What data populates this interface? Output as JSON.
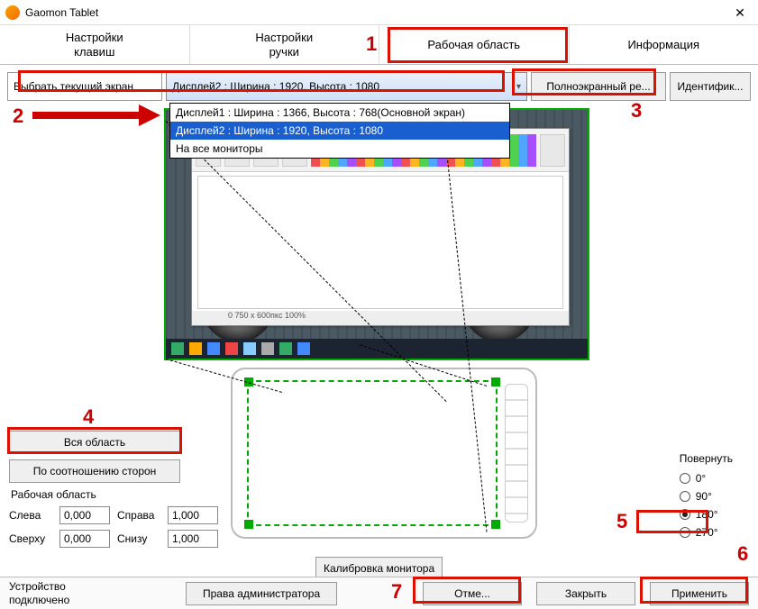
{
  "window": {
    "title": "Gaomon Tablet"
  },
  "tabs": {
    "keys": "Настройки\nклавиш",
    "pen": "Настройки\nручки",
    "work": "Рабочая область",
    "info": "Информация"
  },
  "selector": {
    "label": "Выбрать текущий экран",
    "selected": "Дисплей2 : Ширина : 1920, Высота : 1080",
    "options": {
      "o1": "Дисплей1 : Ширина : 1366, Высота : 768(Основной экран)",
      "o2": "Дисплей2 : Ширина : 1920, Высота : 1080",
      "o3": "На все мониторы"
    },
    "fullscreen": "Полноэкранный ре...",
    "identify": "Идентифик..."
  },
  "paint": {
    "status": "0   750 x 600пкс   100%"
  },
  "leftPanel": {
    "fullArea": "Вся область",
    "aspect": "По соотношению сторон",
    "waTitle": "Рабочая область",
    "left": "Слева",
    "right": "Справа",
    "top": "Сверху",
    "bottom": "Снизу",
    "vLeft": "0,000",
    "vRight": "1,000",
    "vTop": "0,000",
    "vBottom": "1,000"
  },
  "rotate": {
    "title": "Повернуть",
    "r0": "0°",
    "r90": "90°",
    "r180": "180°",
    "r270": "270°",
    "selected": "180"
  },
  "calib": "Калибровка монитора",
  "bottom": {
    "device": "Устройство\nподключено",
    "admin": "Права администратора",
    "cancel": "Отме...",
    "close": "Закрыть",
    "apply": "Применить"
  },
  "annotations": {
    "n1": "1",
    "n2": "2",
    "n3": "3",
    "n4": "4",
    "n5": "5",
    "n6": "6",
    "n7": "7"
  }
}
